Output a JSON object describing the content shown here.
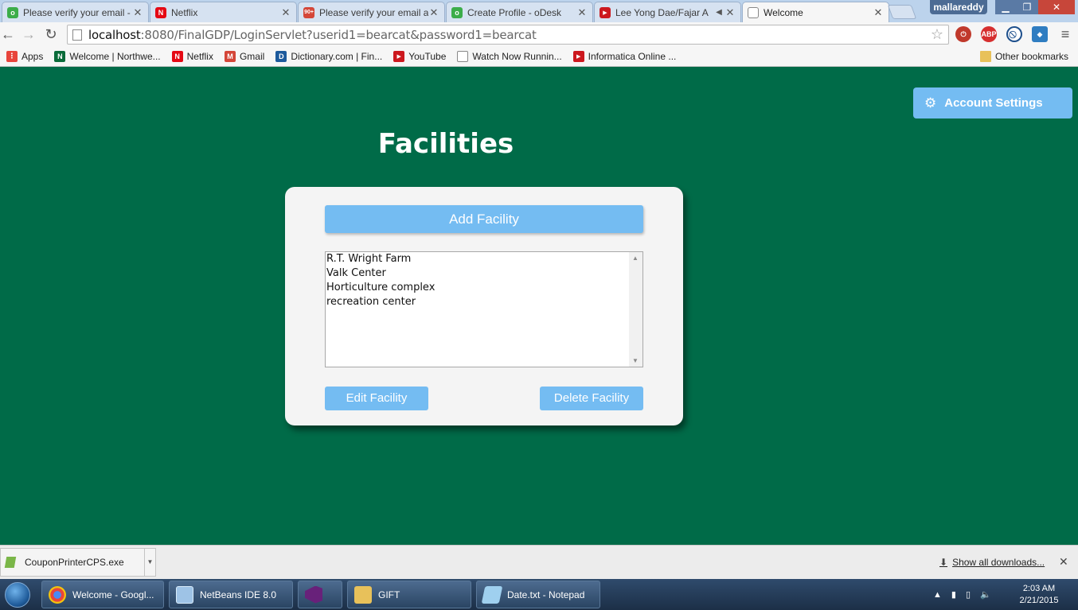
{
  "browser": {
    "tabs": [
      {
        "title": "Please verify your email -",
        "favicon": "odesk-icon",
        "color": "#3cad4a",
        "glyph": "o"
      },
      {
        "title": "Netflix",
        "favicon": "netflix-icon",
        "color": "#e50914",
        "glyph": "N"
      },
      {
        "title": "Please verify your email a",
        "favicon": "gmail-icon",
        "color": "#d44638",
        "glyph": "M"
      },
      {
        "title": "Create Profile - oDesk",
        "favicon": "odesk-icon",
        "color": "#3cad4a",
        "glyph": "o"
      },
      {
        "title": "Lee Yong Dae/Fajar A",
        "favicon": "youtube-icon",
        "color": "#cc181e",
        "glyph": "▶"
      },
      {
        "title": "Welcome",
        "favicon": "page-icon",
        "color": "#ffffff",
        "glyph": ""
      }
    ],
    "gmail_badge": "90+",
    "user": "mallareddy",
    "url_host": "localhost",
    "url_rest": ":8080/FinalGDP/LoginServlet?userid1=bearcat&password1=bearcat",
    "bookmarks": [
      {
        "label": "Apps",
        "icon": "apps-icon",
        "color": "#e8453c",
        "glyph": "⋮"
      },
      {
        "label": "Welcome | Northwe...",
        "icon": "northwest-icon",
        "color": "#0a6b3a",
        "glyph": "N"
      },
      {
        "label": "Netflix",
        "icon": "netflix-icon",
        "color": "#e50914",
        "glyph": "N"
      },
      {
        "label": "Gmail",
        "icon": "gmail-icon",
        "color": "#d44638",
        "glyph": "M"
      },
      {
        "label": "Dictionary.com | Fin...",
        "icon": "dictionary-icon",
        "color": "#1d5a9c",
        "glyph": "D"
      },
      {
        "label": "YouTube",
        "icon": "youtube-icon",
        "color": "#cc181e",
        "glyph": "▶"
      },
      {
        "label": "Watch Now Runnin...",
        "icon": "page-icon",
        "color": "#ffffff",
        "glyph": ""
      },
      {
        "label": "Informatica Online ...",
        "icon": "youtube-icon",
        "color": "#cc181e",
        "glyph": "▶"
      }
    ],
    "other_bookmarks": "Other bookmarks"
  },
  "page": {
    "account_settings": "Account Settings",
    "title": "Facilities",
    "add_facility": "Add Facility",
    "facilities": [
      "R.T. Wright Farm",
      "Valk Center",
      "Horticulture complex",
      "recreation center"
    ],
    "edit_facility": "Edit Facility",
    "delete_facility": "Delete Facility"
  },
  "downloads": {
    "file": "CouponPrinterCPS.exe",
    "show_all": "Show all downloads..."
  },
  "taskbar": {
    "items": [
      {
        "label": "Welcome - Googl...",
        "icon": "chrome-icon",
        "color": "#e8453c"
      },
      {
        "label": "NetBeans IDE 8.0",
        "icon": "netbeans-icon",
        "color": "#9ec3e6"
      },
      {
        "label": "",
        "icon": "visual-studio-icon",
        "color": "#68217a"
      },
      {
        "label": "GIFT",
        "icon": "folder-icon",
        "color": "#e8c15a"
      },
      {
        "label": "Date.txt - Notepad",
        "icon": "notepad-icon",
        "color": "#9fd0ef"
      }
    ],
    "time": "2:03 AM",
    "date": "2/21/2015"
  },
  "colors": {
    "page_bg": "#006b48",
    "button_blue": "#74bcf2",
    "card_bg": "#f4f4f4"
  }
}
